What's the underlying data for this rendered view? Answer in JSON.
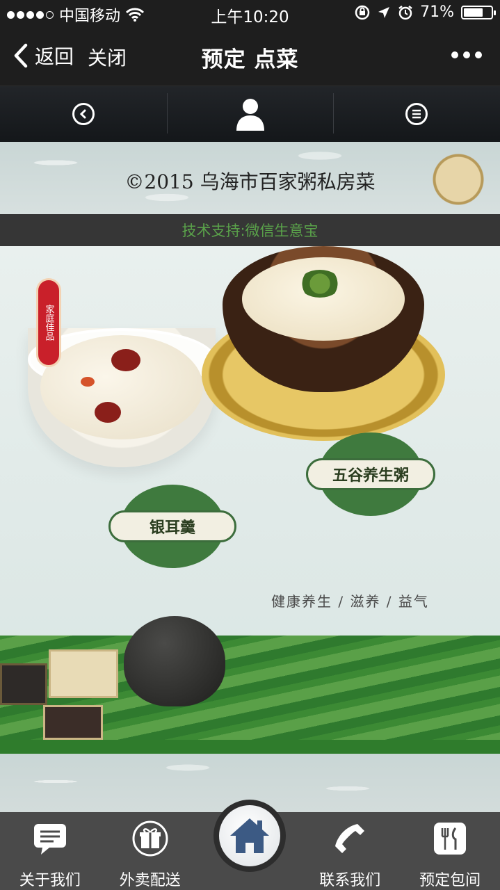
{
  "status_bar": {
    "carrier": "中国移动",
    "time": "上午10:20",
    "battery": "71%",
    "battery_level": 0.71,
    "icons": [
      "signal-dots",
      "wifi-icon",
      "orientation-lock-icon",
      "location-arrow-icon",
      "alarm-icon",
      "battery-icon"
    ]
  },
  "navbar": {
    "back_label": "返回",
    "close_label": "关闭",
    "title": "预定 点菜",
    "more_icon": "more-dots-icon"
  },
  "toolbar": {
    "items": [
      {
        "icon": "back-circle-icon"
      },
      {
        "icon": "user-icon"
      },
      {
        "icon": "menu-circle-icon"
      }
    ]
  },
  "content": {
    "copyright": "©2015 乌海市百家粥私房菜",
    "support": "技术支持:微信生意宝",
    "poster": {
      "badge": "家庭佳品",
      "emblem_right": "五谷养生粥",
      "emblem_left": "银耳羹",
      "tagline": "健康养生 / 滋养 / 益气"
    }
  },
  "tabbar": {
    "items": [
      {
        "label": "关于我们",
        "icon": "chat-icon"
      },
      {
        "label": "外卖配送",
        "icon": "gift-icon"
      },
      {
        "label": "",
        "icon": "home-icon"
      },
      {
        "label": "联系我们",
        "icon": "phone-icon"
      },
      {
        "label": "预定包间",
        "icon": "utensils-icon"
      }
    ]
  },
  "colors": {
    "bar_bg": "#1e1e1e",
    "tab_bg": "#4a4a4a",
    "support_text": "#5aa24a",
    "home_blue": "#3c5a84"
  }
}
